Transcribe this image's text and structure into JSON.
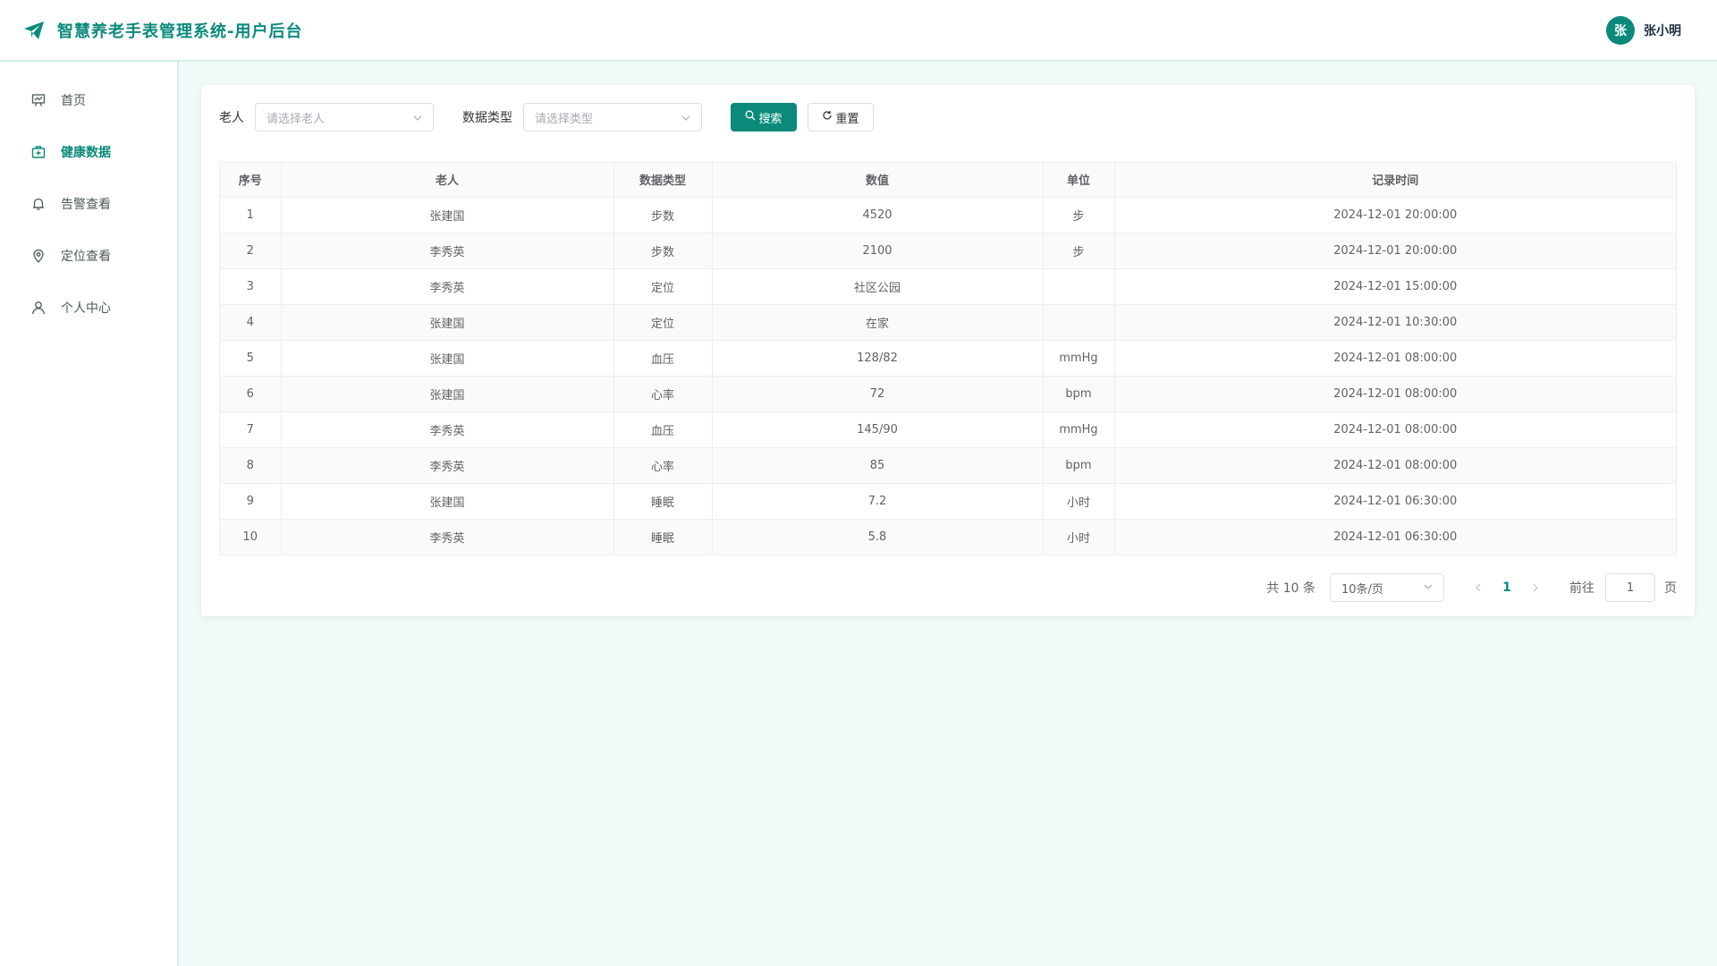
{
  "header": {
    "title": "智慧养老手表管理系统-用户后台",
    "user_avatar_text": "张",
    "user_name": "张小明"
  },
  "sidebar": {
    "items": [
      {
        "label": "首页",
        "icon": "presentation-icon",
        "active": false
      },
      {
        "label": "健康数据",
        "icon": "medical-kit-icon",
        "active": true
      },
      {
        "label": "告警查看",
        "icon": "bell-icon",
        "active": false
      },
      {
        "label": "定位查看",
        "icon": "location-pin-icon",
        "active": false
      },
      {
        "label": "个人中心",
        "icon": "user-icon",
        "active": false
      }
    ]
  },
  "filters": {
    "elder_label": "老人",
    "elder_placeholder": "请选择老人",
    "type_label": "数据类型",
    "type_placeholder": "请选择类型",
    "search_label": "搜索",
    "reset_label": "重置"
  },
  "table": {
    "columns": [
      "序号",
      "老人",
      "数据类型",
      "数值",
      "单位",
      "记录时间"
    ],
    "rows": [
      [
        "1",
        "张建国",
        "步数",
        "4520",
        "步",
        "2024-12-01 20:00:00"
      ],
      [
        "2",
        "李秀英",
        "步数",
        "2100",
        "步",
        "2024-12-01 20:00:00"
      ],
      [
        "3",
        "李秀英",
        "定位",
        "社区公园",
        "",
        "2024-12-01 15:00:00"
      ],
      [
        "4",
        "张建国",
        "定位",
        "在家",
        "",
        "2024-12-01 10:30:00"
      ],
      [
        "5",
        "张建国",
        "血压",
        "128/82",
        "mmHg",
        "2024-12-01 08:00:00"
      ],
      [
        "6",
        "张建国",
        "心率",
        "72",
        "bpm",
        "2024-12-01 08:00:00"
      ],
      [
        "7",
        "李秀英",
        "血压",
        "145/90",
        "mmHg",
        "2024-12-01 08:00:00"
      ],
      [
        "8",
        "李秀英",
        "心率",
        "85",
        "bpm",
        "2024-12-01 08:00:00"
      ],
      [
        "9",
        "张建国",
        "睡眠",
        "7.2",
        "小时",
        "2024-12-01 06:30:00"
      ],
      [
        "10",
        "李秀英",
        "睡眠",
        "5.8",
        "小时",
        "2024-12-01 06:30:00"
      ]
    ]
  },
  "pagination": {
    "total_text": "共 10 条",
    "page_size": "10条/页",
    "current_page": "1",
    "goto_label": "前往",
    "goto_value": "1",
    "page_suffix": "页"
  },
  "colors": {
    "accent": "#0b8a7c",
    "background": "#f1fbf9"
  }
}
